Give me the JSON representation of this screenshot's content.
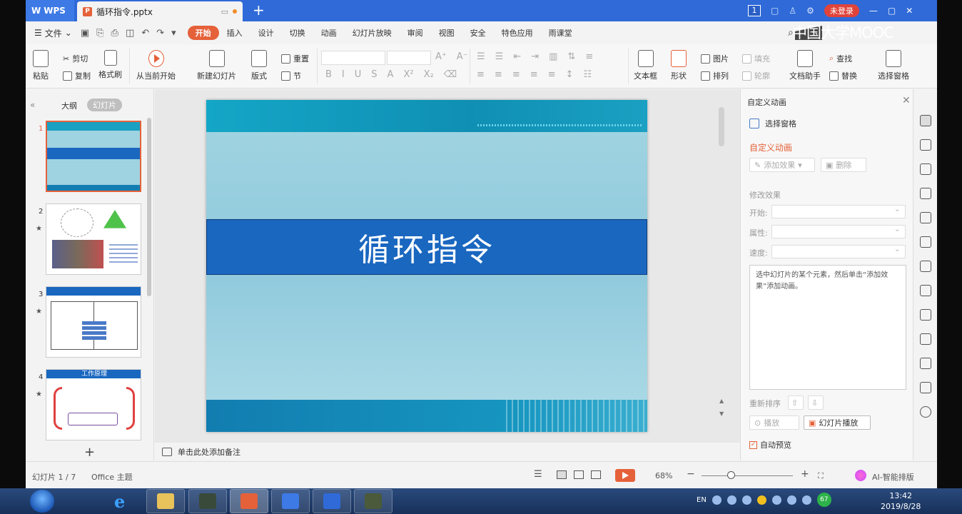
{
  "titlebar": {
    "app_name": "WPS",
    "doc_tab": "循环指令.pptx",
    "new_tab": "+",
    "badge": "1",
    "login": "未登录",
    "watermark": "中国大学MOOC"
  },
  "menu": {
    "file": "文件",
    "tabs": [
      "开始",
      "插入",
      "设计",
      "切换",
      "动画",
      "幻灯片放映",
      "审阅",
      "视图",
      "安全",
      "特色应用",
      "雨课堂"
    ],
    "active_tab": "开始"
  },
  "ribbon": {
    "paste": "粘贴",
    "cut": "剪切",
    "copy": "复制",
    "format_painter": "格式刷",
    "from_current": "从当前开始",
    "new_slide": "新建幻灯片",
    "layout": "版式",
    "reset": "重置",
    "section": "节",
    "textbox": "文本框",
    "shape": "形状",
    "picture": "图片",
    "fill": "填充",
    "arrange": "排列",
    "outline": "轮廓",
    "doc_assistant": "文档助手",
    "find": "查找",
    "replace": "替换",
    "select_pane": "选择窗格"
  },
  "left_panel": {
    "outline_tab": "大纲",
    "slides_tab": "幻灯片",
    "thumbnails": [
      {
        "num": "1",
        "title": ""
      },
      {
        "num": "2",
        "title": ""
      },
      {
        "num": "3",
        "title": ""
      },
      {
        "num": "4",
        "title": "工作原理"
      }
    ],
    "add": "+"
  },
  "slide": {
    "title": "循环指令"
  },
  "notes": {
    "placeholder": "单击此处添加备注"
  },
  "right_panel": {
    "header": "自定义动画",
    "select_pane": "选择窗格",
    "title": "自定义动画",
    "add_effect": "添加效果",
    "delete": "删除",
    "modify_effect": "修改效果",
    "start_label": "开始:",
    "property_label": "属性:",
    "speed_label": "速度:",
    "hint": "选中幻灯片的某个元素，然后单击“添加效果”添加动画。",
    "reorder": "重新排序",
    "play": "播放",
    "slideshow": "幻灯片播放",
    "autopreview": "自动预览"
  },
  "status": {
    "slide_counter": "幻灯片 1 / 7",
    "theme": "Office 主题",
    "zoom": "68%",
    "minus": "−",
    "plus": "+",
    "ai_layout": "AI-智能排版"
  },
  "taskbar": {
    "lang": "EN",
    "tray_badge": "67",
    "time": "13:42",
    "date": "2019/8/28"
  },
  "colors": {
    "accent": "#e5613a",
    "titlebar": "#2f6ad8",
    "slide_band": "#1a67c0"
  }
}
